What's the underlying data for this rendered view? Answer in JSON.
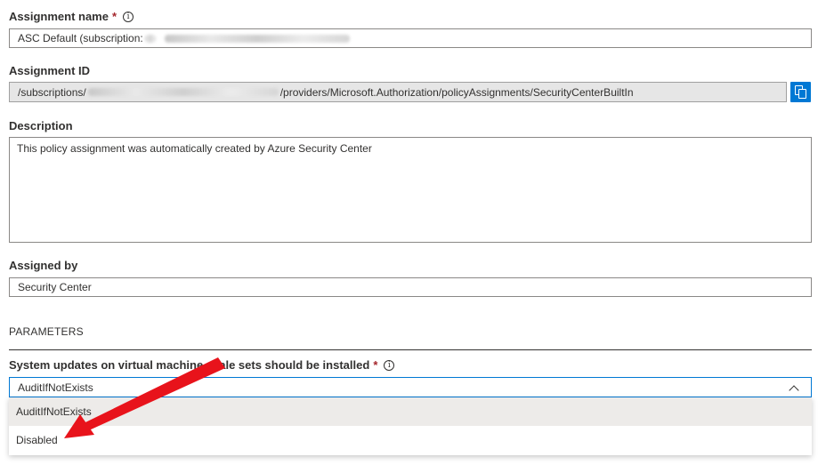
{
  "assignment_name": {
    "label": "Assignment name",
    "required_mark": "*",
    "value": "ASC Default (subscription: "
  },
  "assignment_id": {
    "label": "Assignment ID",
    "value_prefix": "/subscriptions/",
    "value_suffix": "/providers/Microsoft.Authorization/policyAssignments/SecurityCenterBuiltIn"
  },
  "description": {
    "label": "Description",
    "value": "This policy assignment was automatically created by Azure Security Center"
  },
  "assigned_by": {
    "label": "Assigned by",
    "value": "Security Center"
  },
  "parameters": {
    "section_title": "PARAMETERS",
    "param_label": "System updates on virtual machine scale sets should be installed",
    "required_mark": "*",
    "selected_value": "AuditIfNotExists",
    "options": [
      "AuditIfNotExists",
      "Disabled"
    ]
  },
  "colors": {
    "accent": "#0078d4",
    "required": "#a4262c",
    "annotation_arrow": "#e8131b"
  },
  "icons": {
    "info": "info-circle-icon",
    "copy": "copy-icon",
    "chevron": "chevron-up-icon"
  }
}
